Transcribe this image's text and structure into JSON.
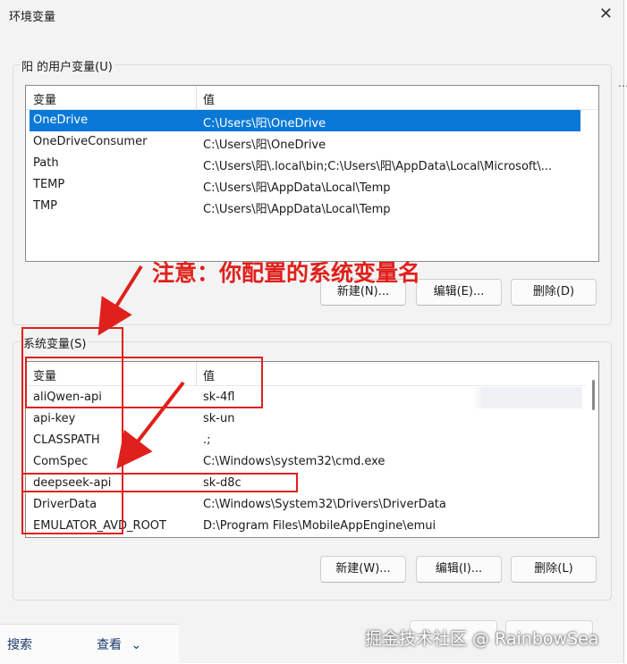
{
  "window": {
    "title": "环境变量",
    "close_glyph": "✕"
  },
  "user_vars": {
    "group_label": "阳 的用户变量(U)",
    "header": {
      "name": "变量",
      "value": "值"
    },
    "rows": [
      {
        "name": "OneDrive",
        "value": "C:\\Users\\阳\\OneDrive"
      },
      {
        "name": "OneDriveConsumer",
        "value": "C:\\Users\\阳\\OneDrive"
      },
      {
        "name": "Path",
        "value": "C:\\Users\\阳\\.local\\bin;C:\\Users\\阳\\AppData\\Local\\Microsoft\\..."
      },
      {
        "name": "TEMP",
        "value": "C:\\Users\\阳\\AppData\\Local\\Temp"
      },
      {
        "name": "TMP",
        "value": "C:\\Users\\阳\\AppData\\Local\\Temp"
      }
    ],
    "buttons": {
      "new": "新建(N)...",
      "edit": "编辑(E)...",
      "delete": "删除(D)"
    }
  },
  "system_vars": {
    "group_label": "系统变量(S)",
    "header": {
      "name": "变量",
      "value": "值"
    },
    "rows": [
      {
        "name": "aliQwen-api",
        "value": "sk-4fl"
      },
      {
        "name": "api-key",
        "value": "sk-un"
      },
      {
        "name": "CLASSPATH",
        "value": ".;"
      },
      {
        "name": "ComSpec",
        "value": "C:\\Windows\\system32\\cmd.exe"
      },
      {
        "name": "deepseek-api",
        "value": "sk-d8c"
      },
      {
        "name": "DriverData",
        "value": "C:\\Windows\\System32\\Drivers\\DriverData"
      },
      {
        "name": "EMULATOR_AVD_ROOT",
        "value": "D:\\Program Files\\MobileAppEngine\\emui"
      }
    ],
    "buttons": {
      "new": "新建(W)...",
      "edit": "编辑(I)...",
      "delete": "删除(L)"
    }
  },
  "annotation": {
    "text": "注意：你配置的系统变量名",
    "color": "#e0201c"
  },
  "taskbar": {
    "search": "搜索",
    "view": "查看"
  },
  "watermark": "掘金技术社区 @ RainbowSea",
  "colors": {
    "selection": "#0a78d7",
    "annotation_red": "#e0201c",
    "dialog_bg": "#f3f3f3"
  }
}
